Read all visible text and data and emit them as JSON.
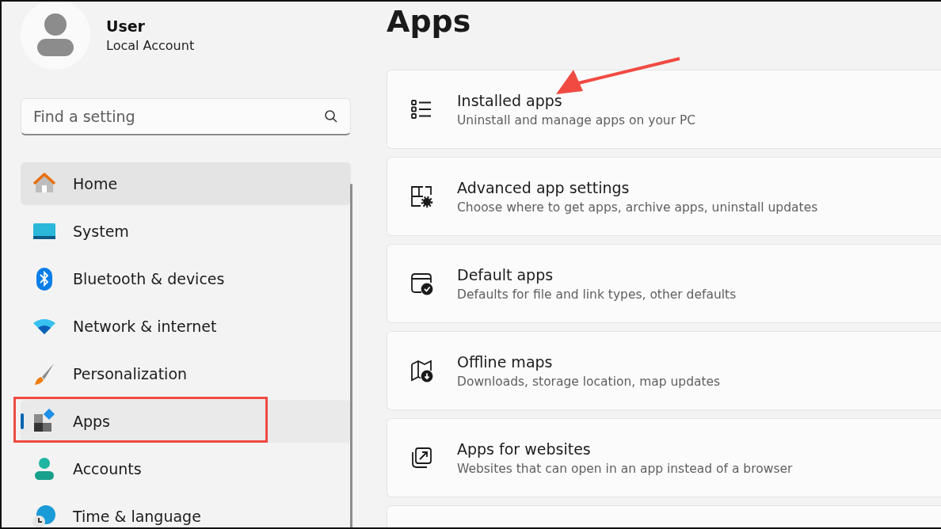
{
  "account": {
    "name": "User",
    "type": "Local Account"
  },
  "search": {
    "placeholder": "Find a setting"
  },
  "nav": [
    {
      "label": "Home",
      "kind": "home",
      "selected": false,
      "hovered": true,
      "annotated": false
    },
    {
      "label": "System",
      "kind": "system",
      "selected": false,
      "hovered": false,
      "annotated": false
    },
    {
      "label": "Bluetooth & devices",
      "kind": "bluetooth",
      "selected": false,
      "hovered": false,
      "annotated": false
    },
    {
      "label": "Network & internet",
      "kind": "network",
      "selected": false,
      "hovered": false,
      "annotated": false
    },
    {
      "label": "Personalization",
      "kind": "brush",
      "selected": false,
      "hovered": false,
      "annotated": false
    },
    {
      "label": "Apps",
      "kind": "apps",
      "selected": true,
      "hovered": false,
      "annotated": true
    },
    {
      "label": "Accounts",
      "kind": "accounts",
      "selected": false,
      "hovered": false,
      "annotated": false
    },
    {
      "label": "Time & language",
      "kind": "time",
      "selected": false,
      "hovered": false,
      "annotated": false
    }
  ],
  "page_title": "Apps",
  "cards": [
    {
      "kind": "list",
      "title": "Installed apps",
      "subtitle": "Uninstall and manage apps on your PC",
      "arrow": true
    },
    {
      "kind": "advanced",
      "title": "Advanced app settings",
      "subtitle": "Choose where to get apps, archive apps, uninstall updates",
      "arrow": false
    },
    {
      "kind": "default",
      "title": "Default apps",
      "subtitle": "Defaults for file and link types, other defaults",
      "arrow": false
    },
    {
      "kind": "map",
      "title": "Offline maps",
      "subtitle": "Downloads, storage location, map updates",
      "arrow": false
    },
    {
      "kind": "web",
      "title": "Apps for websites",
      "subtitle": "Websites that can open in an app instead of a browser",
      "arrow": false
    },
    {
      "kind": "blank",
      "arrow": false
    }
  ]
}
